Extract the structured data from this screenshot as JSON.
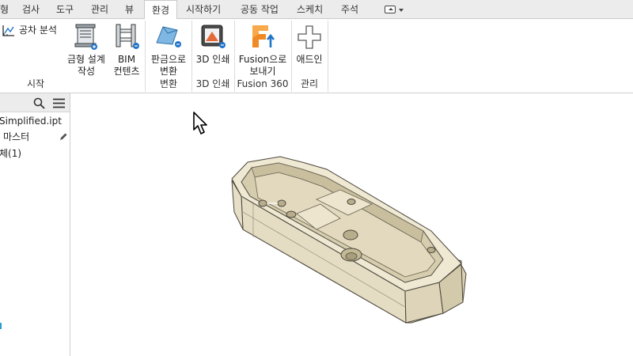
{
  "ribbon_tabs": [
    {
      "label": "형",
      "active": false
    },
    {
      "label": "검사",
      "active": false
    },
    {
      "label": "도구",
      "active": false
    },
    {
      "label": "관리",
      "active": false
    },
    {
      "label": "뷰",
      "active": false
    },
    {
      "label": "환경",
      "active": true
    },
    {
      "label": "시작하기",
      "active": false
    },
    {
      "label": "공동 작업",
      "active": false
    },
    {
      "label": "스케치",
      "active": false
    },
    {
      "label": "주석",
      "active": false
    }
  ],
  "ribbon": {
    "tolerance_analysis": "공차 분석",
    "sheet_metal_design": "금형 설계\n작성",
    "bim_content": "BIM\n컨텐츠",
    "group_start": "시작",
    "convert_sheet_metal": "판금으로\n변환",
    "group_convert": "변환",
    "print_3d": "3D 인쇄",
    "group_3d_print": "3D 인쇄",
    "send_fusion": "Fusion으로\n보내기",
    "group_fusion": "Fusion 360",
    "addins": "애드인",
    "group_manage": "관리"
  },
  "browser": {
    "file_name": "Simplified.ipt",
    "master": "마스터",
    "body": "체(1)"
  },
  "colors": {
    "part_face": "#ebe3cc",
    "part_inner": "#d7cdb0",
    "part_edge": "#4a463b",
    "fusion_orange": "#f08a24",
    "accent_blue": "#1f74c9"
  }
}
